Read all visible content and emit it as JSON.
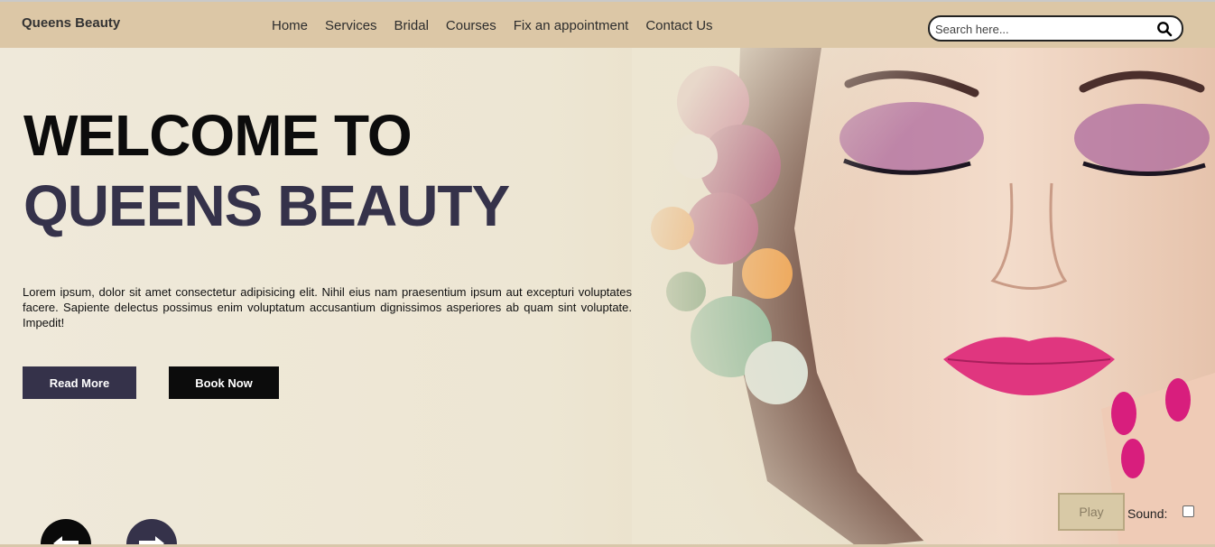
{
  "brand": "Queens Beauty",
  "nav": {
    "home": "Home",
    "services": "Services",
    "bridal": "Bridal",
    "courses": "Courses",
    "appointment": "Fix an appointment",
    "contact": "Contact Us"
  },
  "search": {
    "placeholder": "Search here...",
    "icon": "search-icon"
  },
  "hero": {
    "title_line1": "WELCOME TO",
    "title_line2": "QUEENS BEAUTY",
    "lead": "Lorem ipsum, dolor sit amet consectetur adipisicing elit. Nihil eius nam praesentium ipsum aut excepturi voluptates facere. Sapiente delectus possimus enim voluptatum accusantium dignissimos asperiores ab quam sint voluptate. Impedit!",
    "read_more": "Read More",
    "book_now": "Book Now"
  },
  "slider": {
    "prev_icon": "arrow-left-icon",
    "next_icon": "arrow-right-icon"
  },
  "media": {
    "play": "Play",
    "sound": "Sound:"
  },
  "colors": {
    "header": "#dcc7a6",
    "accent": "#35324a",
    "dark": "#0c0c0c"
  }
}
